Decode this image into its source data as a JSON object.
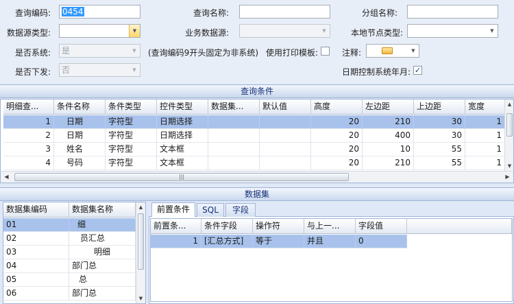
{
  "form": {
    "query_code_label": "查询编码:",
    "query_code_value": "0454",
    "query_name_label": "查询名称:",
    "group_name_label": "分组名称:",
    "datasource_type_label": "数据源类型:",
    "biz_datasource_label": "业务数据源:",
    "local_node_type_label": "本地节点类型:",
    "is_system_label": "是否系统:",
    "is_system_value": "是",
    "system_hint": "(查询编码9开头固定为非系统)",
    "use_print_template_label": "使用打印模板:",
    "note_label": "注释:",
    "is_dispatch_label": "是否下发:",
    "is_dispatch_value": "否",
    "date_control_label": "日期控制系统年月:",
    "date_control_checked": "✓"
  },
  "conditions": {
    "title": "查询条件",
    "columns": [
      "明细查...",
      "条件名称",
      "条件类型",
      "控件类型",
      "数据集...",
      "默认值",
      "高度",
      "左边距",
      "上边距",
      "宽度"
    ],
    "rows": [
      {
        "seq": "1",
        "name": "日期",
        "type": "字符型",
        "control": "日期选择",
        "height": "20",
        "left": "210",
        "top": "30",
        "width": "1"
      },
      {
        "seq": "2",
        "name": "日期",
        "type": "字符型",
        "control": "日期选择",
        "height": "20",
        "left": "400",
        "top": "30",
        "width": "1"
      },
      {
        "seq": "3",
        "name": "姓名",
        "type": "字符型",
        "control": "文本框",
        "height": "20",
        "left": "10",
        "top": "55",
        "width": "1"
      },
      {
        "seq": "4",
        "name": "号码",
        "type": "字符型",
        "control": "文本框",
        "height": "20",
        "left": "210",
        "top": "55",
        "width": "1"
      }
    ]
  },
  "dataset": {
    "title": "数据集",
    "columns": [
      "数据集编码",
      "数据集名称"
    ],
    "rows": [
      {
        "code": "01",
        "name": "细"
      },
      {
        "code": "02",
        "name": "员汇总"
      },
      {
        "code": "03",
        "name": "明细"
      },
      {
        "code": "04",
        "name": "部门总"
      },
      {
        "code": "05",
        "name": "总"
      },
      {
        "code": "06",
        "name": "部门总"
      }
    ],
    "tabs": [
      "前置条件",
      "SQL",
      "字段"
    ],
    "pre_columns": [
      "前置条...",
      "条件字段",
      "操作符",
      "与上一...",
      "字段值"
    ],
    "pre_rows": [
      {
        "idx": "1",
        "field": "[汇总方式]",
        "op": "等于",
        "link": "并且",
        "value": "0"
      }
    ]
  },
  "colors": {
    "selection": "#a8c2ec",
    "section_text": "#15317a",
    "text_highlight": "#3399ff"
  },
  "icons": [
    "dropdown-arrow-icon",
    "scroll-left-icon",
    "scroll-right-icon",
    "scroll-up-icon",
    "scroll-down-icon",
    "note-envelope-icon"
  ]
}
